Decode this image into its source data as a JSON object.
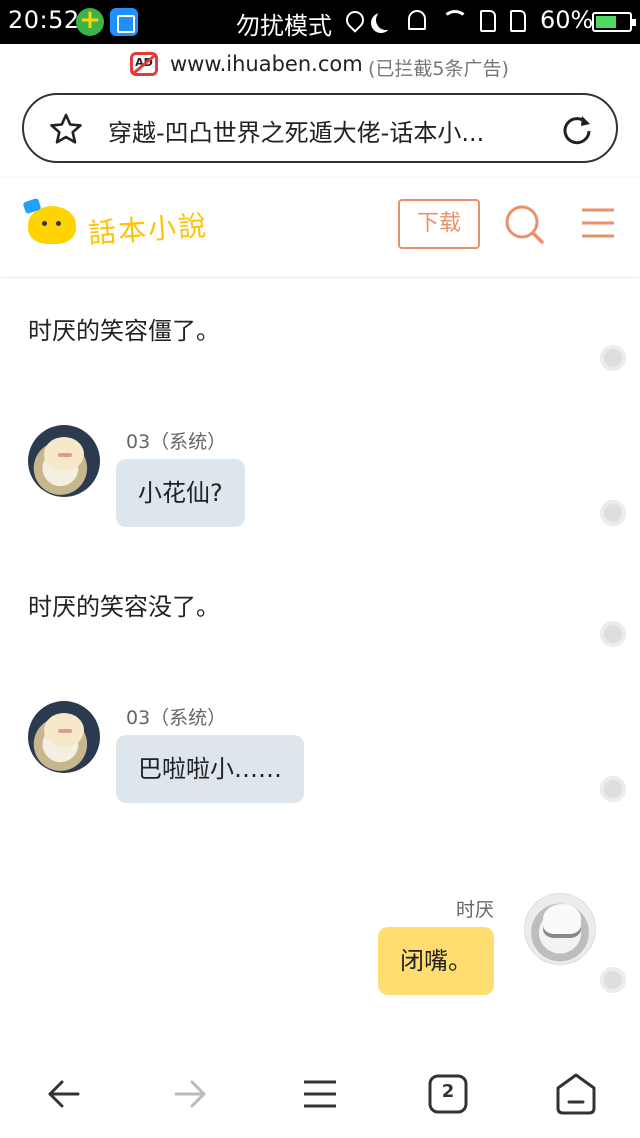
{
  "status_bar": {
    "time": "20:52",
    "mode": "勿扰模式",
    "battery": "60%"
  },
  "url_strip": {
    "ad_icon": "AD",
    "url": "www.ihuaben.com",
    "ads_blocked": "(已拦截5条广告)"
  },
  "address_bar": {
    "title": "穿越-凹凸世界之死遁大佬-话本小...",
    "star_icon": "star-icon",
    "refresh_icon": "refresh-icon"
  },
  "site_header": {
    "logo_text": "話本小說",
    "download_label": "下载",
    "accent_color": "#e9916a",
    "logo_color": "#ffc200"
  },
  "chat": {
    "narration_1": "时厌的笑容僵了。",
    "msg_1": {
      "speaker": "03（系统）",
      "text": "小花仙?"
    },
    "narration_2": "时厌的笑容没了。",
    "msg_2": {
      "speaker": "03（系统）",
      "text": "巴啦啦小……"
    },
    "msg_3": {
      "speaker": "时厌",
      "text": "闭嘴。"
    },
    "system_bubble_color": "#dde6ed",
    "user_bubble_color": "#ffdd70"
  },
  "bottom_nav": {
    "tabs_count": "2"
  }
}
